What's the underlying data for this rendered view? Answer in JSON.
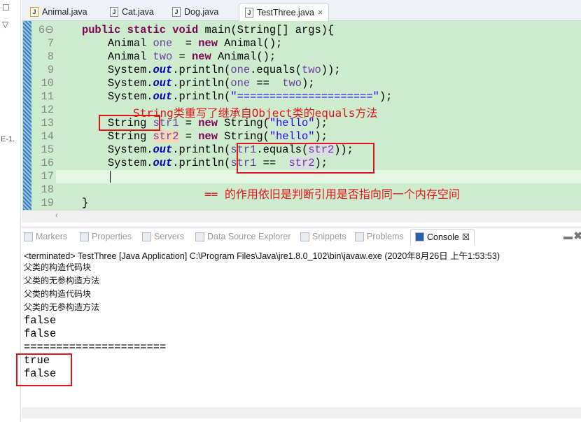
{
  "editor_tabs": [
    {
      "label": "Animal.java",
      "warning": true
    },
    {
      "label": "Cat.java"
    },
    {
      "label": "Dog.java"
    },
    {
      "label": "TestThree.java",
      "active": true,
      "close": "×"
    }
  ],
  "gutter_label": "E-1.",
  "code": [
    {
      "n": "6⊖",
      "t": [
        [
          "    "
        ],
        [
          "public",
          "kw"
        ],
        [
          " "
        ],
        [
          "static",
          "kw"
        ],
        [
          " "
        ],
        [
          "void",
          "kw"
        ],
        [
          " main(String[] args){"
        ]
      ]
    },
    {
      "n": "7",
      "t": [
        [
          "        Animal "
        ],
        [
          "one",
          "var"
        ],
        [
          "  = "
        ],
        [
          "new",
          "kw"
        ],
        [
          " Animal();"
        ]
      ]
    },
    {
      "n": "8",
      "t": [
        [
          "        Animal "
        ],
        [
          "two",
          "var"
        ],
        [
          " = "
        ],
        [
          "new",
          "kw"
        ],
        [
          " Animal();"
        ]
      ]
    },
    {
      "n": "9",
      "t": [
        [
          "        System."
        ],
        [
          "out",
          "st"
        ],
        [
          ".println("
        ],
        [
          "one",
          "var"
        ],
        [
          ".equals("
        ],
        [
          "two",
          "var"
        ],
        [
          "));"
        ]
      ]
    },
    {
      "n": "10",
      "t": [
        [
          "        System."
        ],
        [
          "out",
          "st"
        ],
        [
          ".println("
        ],
        [
          "one",
          "var"
        ],
        [
          " ==  "
        ],
        [
          "two",
          "var"
        ],
        [
          ");"
        ]
      ]
    },
    {
      "n": "11",
      "t": [
        [
          "        System."
        ],
        [
          "out",
          "st"
        ],
        [
          ".println("
        ],
        [
          "\"=====================\"",
          "str"
        ],
        [
          ");"
        ]
      ]
    },
    {
      "n": "12",
      "t": [
        [
          ""
        ]
      ]
    },
    {
      "n": "13",
      "t": [
        [
          "        String "
        ],
        [
          "str1",
          "var"
        ],
        [
          " = "
        ],
        [
          "new",
          "kw"
        ],
        [
          " String("
        ],
        [
          "\"hello\"",
          "str"
        ],
        [
          ");"
        ]
      ]
    },
    {
      "n": "14",
      "t": [
        [
          "        String "
        ],
        [
          "str2",
          "var hl"
        ],
        [
          " = "
        ],
        [
          "new",
          "kw"
        ],
        [
          " String("
        ],
        [
          "\"hello\"",
          "str"
        ],
        [
          ");"
        ]
      ]
    },
    {
      "n": "15",
      "t": [
        [
          "        System."
        ],
        [
          "out",
          "st"
        ],
        [
          ".println("
        ],
        [
          "str1",
          "var"
        ],
        [
          ".equals("
        ],
        [
          "str2",
          "var hl2"
        ],
        [
          "));"
        ]
      ]
    },
    {
      "n": "16",
      "t": [
        [
          "        System."
        ],
        [
          "out",
          "st"
        ],
        [
          ".println("
        ],
        [
          "str1",
          "var"
        ],
        [
          " ==  "
        ],
        [
          "str2",
          "var hl2"
        ],
        [
          ");"
        ]
      ]
    },
    {
      "n": "17",
      "t": [
        [
          ""
        ]
      ],
      "current": true
    },
    {
      "n": "18",
      "t": [
        [
          ""
        ]
      ]
    },
    {
      "n": "19",
      "t": [
        [
          "    }"
        ]
      ]
    }
  ],
  "annotations": {
    "equals_note": "String类重写了继承自Object类的equals方法",
    "eq_note": "== 的作用依旧是判断引用是否指向同一个内存空间"
  },
  "panel_tabs": [
    {
      "label": "Markers"
    },
    {
      "label": "Properties"
    },
    {
      "label": "Servers"
    },
    {
      "label": "Data Source Explorer"
    },
    {
      "label": "Snippets"
    },
    {
      "label": "Problems"
    },
    {
      "label": "Console",
      "active": true,
      "close": "☒"
    }
  ],
  "console": {
    "terminated": "<terminated> TestThree [Java Application] C:\\Program Files\\Java\\jre1.8.0_102\\bin\\javaw.exe (2020年8月26日 上午1:53:53)",
    "lines": [
      {
        "text": "父类的构造代码块",
        "cn": true
      },
      {
        "text": "父类的无参构造方法",
        "cn": true
      },
      {
        "text": "父类的构造代码块",
        "cn": true
      },
      {
        "text": "父类的无参构造方法",
        "cn": true
      },
      {
        "text": "false"
      },
      {
        "text": "false"
      },
      {
        "text": "======================"
      },
      {
        "text": "true"
      },
      {
        "text": "false"
      }
    ]
  }
}
